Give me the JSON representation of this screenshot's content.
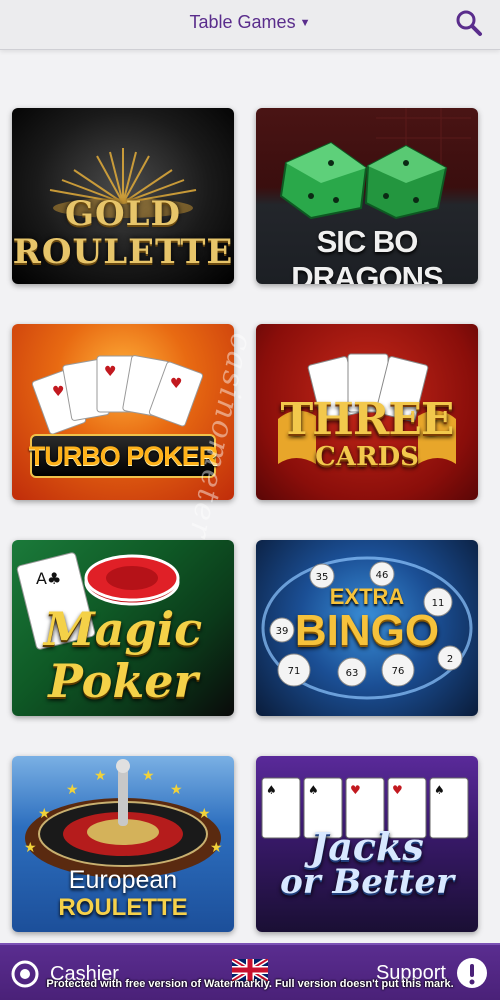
{
  "header": {
    "title": "Table Games",
    "dropdown_icon": "caret-down-icon",
    "search_icon": "search-icon"
  },
  "games": [
    {
      "id": "gold-roulette",
      "line1": "GOLD",
      "line2": "ROULETTE"
    },
    {
      "id": "sic-bo-dragons",
      "line1": "SIC BO DRAGONS"
    },
    {
      "id": "turbo-poker",
      "line1": "TURBO POKER"
    },
    {
      "id": "three-cards",
      "line1": "THREE",
      "line2": "CARDS"
    },
    {
      "id": "magic-poker",
      "line1": "Magic",
      "line2": "Poker"
    },
    {
      "id": "extra-bingo",
      "line1": "EXTRA",
      "line2": "BINGO"
    },
    {
      "id": "european-roulette",
      "line1": "European",
      "line2": "ROULETTE"
    },
    {
      "id": "jacks-or-better",
      "line1": "Jacks",
      "line2": "or Better"
    }
  ],
  "watermark_text": "casinometer",
  "footer": {
    "cashier_label": "Cashier",
    "support_label": "Support",
    "language": "English",
    "notice": "Protected with free version of Watermarkly. Full version doesn't put this mark."
  },
  "colors": {
    "header_text": "#5a2d8c",
    "footer_bg": "#4a2178",
    "page_bg": "#f2f2f4"
  }
}
